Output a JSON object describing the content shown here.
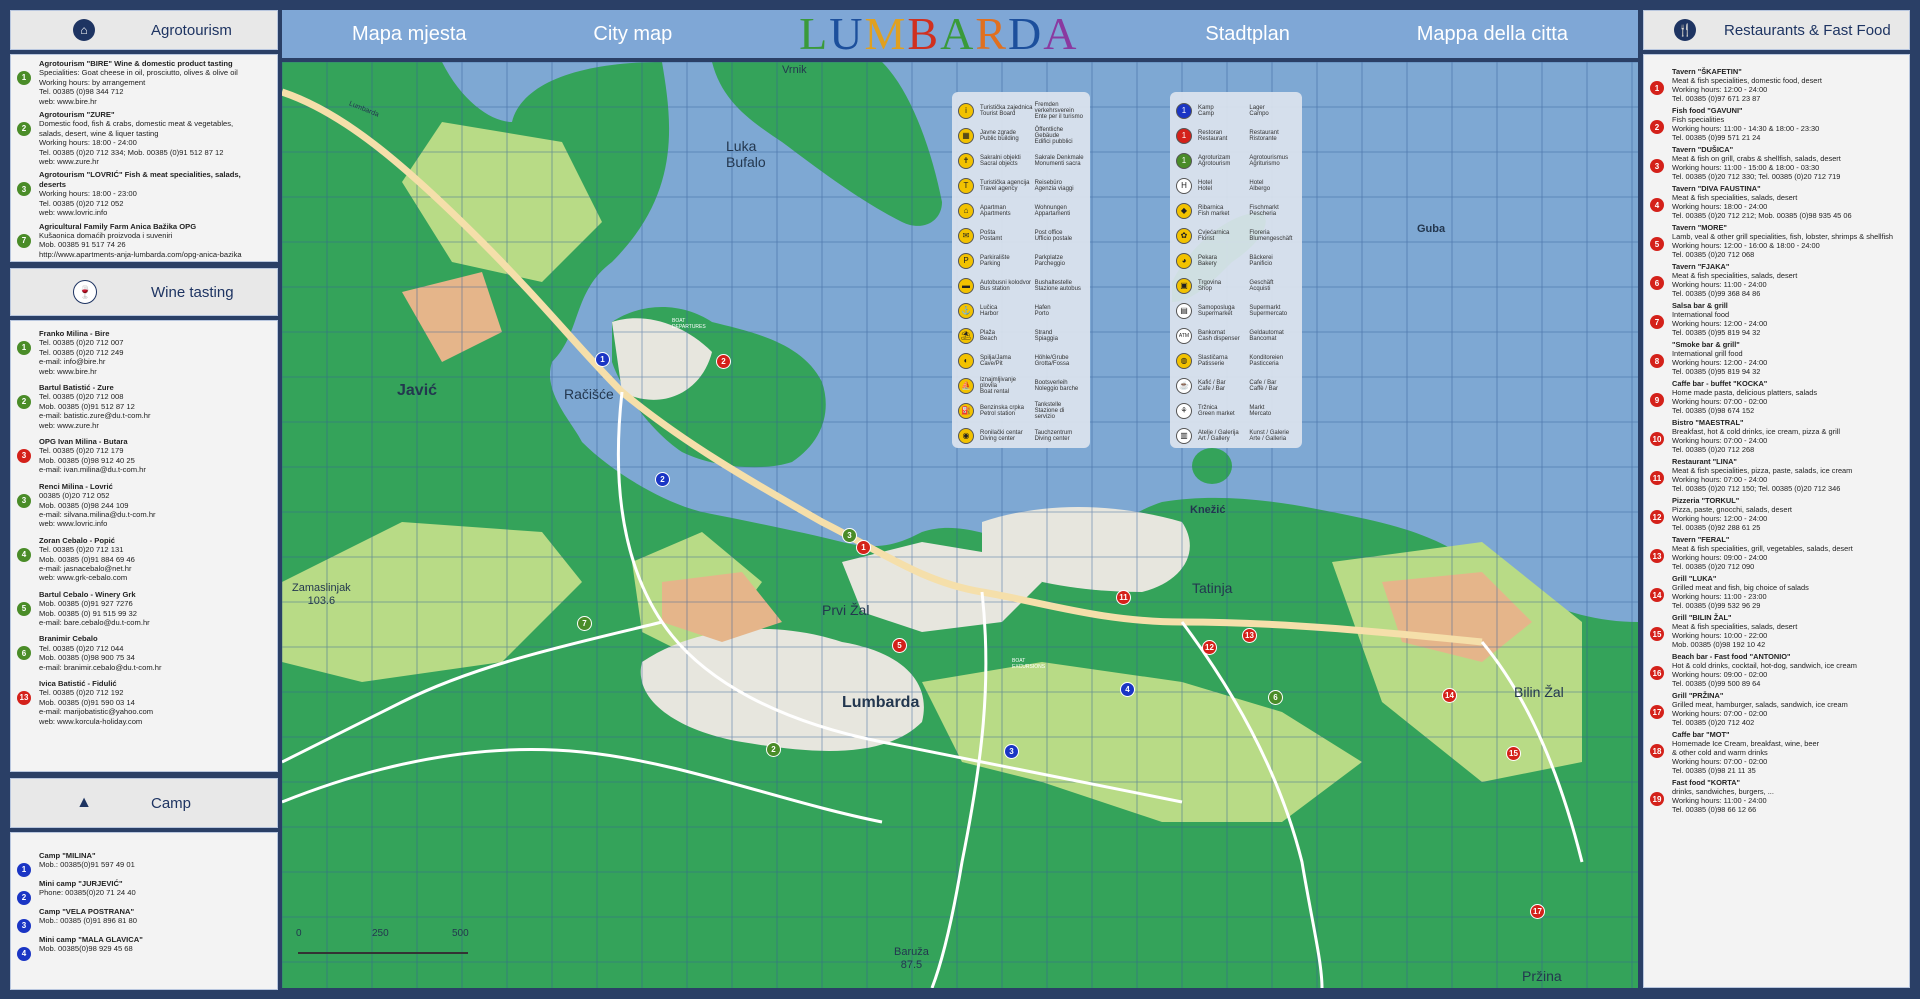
{
  "header": {
    "title_hr": "Mapa mjesta",
    "title_en": "City map",
    "logo": [
      "L",
      "U",
      "M",
      "B",
      "A",
      "R",
      "D",
      "A"
    ],
    "logo_colors": [
      "#3a9a3a",
      "#1c4f9c",
      "#e0a020",
      "#d03020",
      "#3a9a3a",
      "#e07020",
      "#1c4f9c",
      "#8a3aa0"
    ],
    "title_de": "Stadtplan",
    "title_it": "Mappa della citta"
  },
  "colors": {
    "frame": "#2a3f66",
    "header": "#7fa7d6",
    "sea": "#7ea8d3",
    "land": "#34a35a",
    "light_land": "#b8db86",
    "pale_land": "#e7e6de",
    "orange": "#e5b58a",
    "red_marker": "#d4211a",
    "green_marker": "#4a8c28",
    "blue_marker": "#1a35c4"
  },
  "left": {
    "agro": {
      "title": "Agrotourism",
      "icon": "house-icon",
      "entries": [
        {
          "n": "1",
          "color": "#4a8c28",
          "lines": [
            "Agrotourism \"BIRE\" Wine & domestic product tasting",
            "Specialities: Goat cheese in oil, prosciutto, olives & olive oil",
            "Working hours: by arrangement",
            "Tel. 00385 (0)98 344 712",
            "web: www.bire.hr"
          ]
        },
        {
          "n": "2",
          "color": "#4a8c28",
          "lines": [
            "Agrotourism \"ZURE\"",
            "Domestic food, fish & crabs, domestic meat & vegetables,",
            "salads, desert, wine & liquer tasting",
            "Working hours: 18:00 - 24:00",
            "Tel. 00385 (0)20 712 334; Mob. 00385 (0)91 512 87 12",
            "web: www.zure.hr"
          ]
        },
        {
          "n": "3",
          "color": "#4a8c28",
          "lines": [
            "Agrotourism \"LOVRIĆ\" Fish & meat specialities, salads, deserts",
            "Working hours: 18:00 - 23:00",
            "Tel. 00385 (0)20 712 052",
            "web: www.lovric.info"
          ]
        },
        {
          "n": "7",
          "color": "#4a8c28",
          "lines": [
            "Agricultural Family Farm Anica Bažika  OPG",
            "Kušaonica domaćih proizvoda i suveniri",
            "Mob. 00385 91 517 74 26",
            "http://www.apartments-anja-lumbarda.com/opg-anica-bazika"
          ]
        }
      ]
    },
    "wine": {
      "title": "Wine tasting",
      "icon": "wine-glass-icon",
      "entries": [
        {
          "n": "1",
          "color": "#4a8c28",
          "lines": [
            "Franko Milina - Bire",
            "Tel. 00385 (0)20 712 007",
            "Tel. 00385 (0)20 712 249",
            "e-mail: info@bire.hr",
            "web: www.bire.hr"
          ]
        },
        {
          "n": "2",
          "color": "#4a8c28",
          "lines": [
            "Bartul Batistić - Zure",
            "Tel. 00385 (0)20 712 008",
            "Mob. 00385 (0)91 512 87 12",
            "e-mail: batistic.zure@du.t-com.hr",
            "web: www.zure.hr"
          ]
        },
        {
          "n": "3",
          "color": "#d4211a",
          "lines": [
            "OPG Ivan Milina - Butara",
            "Tel. 00385 (0)20 712 179",
            "Mob. 00385 (0)98 912 40 25",
            "e-mail: ivan.milina@du.t-com.hr"
          ]
        },
        {
          "n": "3",
          "color": "#4a8c28",
          "lines": [
            "Renci Milina - Lovrić",
            "00385 (0)20 712 052",
            "Mob. 00385 (0)98 244 109",
            "e-mail: silvana.milina@du.t-com.hr",
            "web: www.lovric.info"
          ]
        },
        {
          "n": "4",
          "color": "#4a8c28",
          "lines": [
            "Zoran Cebalo - Popić",
            "Tel. 00385 (0)20 712 131",
            "Mob. 00385 (0)91 884 69 46",
            "e-mail: jasnacebalo@net.hr",
            "web: www.grk-cebalo.com"
          ]
        },
        {
          "n": "5",
          "color": "#4a8c28",
          "lines": [
            "Bartul Cebalo - Winery Grk",
            "Mob. 00385 (0)91 927 7276",
            "Mob. 00385 (0) 91 515 99 32",
            "e-mail: bare.cebalo@du.t-com.hr"
          ]
        },
        {
          "n": "6",
          "color": "#4a8c28",
          "lines": [
            "Branimir Cebalo",
            "Tel. 00385 (0)20 712 044",
            "Mob. 00385 (0)98 900 75 34",
            "e-mail: branimir.cebalo@du.t-com.hr"
          ]
        },
        {
          "n": "13",
          "color": "#d4211a",
          "lines": [
            "Ivica Batistić - Fidulić",
            "Tel. 00385 (0)20 712 192",
            "Mob. 00385 (0)91 590 03 14",
            "e-mail: marijobatistic@yahoo.com",
            "web: www.korcula-holiday.com"
          ]
        }
      ]
    },
    "camp": {
      "title": "Camp",
      "icon": "tent-icon",
      "entries": [
        {
          "n": "1",
          "color": "#1a35c4",
          "lines": [
            "Camp \"MILINA\"",
            "Mob.: 00385(0)91 597 49 01"
          ]
        },
        {
          "n": "2",
          "color": "#1a35c4",
          "lines": [
            "Mini camp \"JURJEVIĆ\"",
            "Phone: 00385(0)20 71 24 40"
          ]
        },
        {
          "n": "3",
          "color": "#1a35c4",
          "lines": [
            "Camp \"VELA POSTRANA\"",
            "Mob.: 00385 (0)91 896 81 80"
          ]
        },
        {
          "n": "4",
          "color": "#1a35c4",
          "lines": [
            "Mini camp \"MALA GLAVICA\"",
            "Mob. 00385(0)98 929 45 68"
          ]
        }
      ]
    }
  },
  "right": {
    "title": "Restaurants & Fast Food",
    "icon": "cutlery-icon",
    "entries": [
      {
        "n": "1",
        "lines": [
          "Tavern \"ŠKAFETIN\"",
          "Meat & fish specialities, domestic food, desert",
          "Working hours: 12:00 - 24:00",
          "Tel. 00385 (0)97 671 23 87"
        ]
      },
      {
        "n": "2",
        "lines": [
          "Fish food \"GAVUNI\"",
          "Fish specialities",
          "Working hours: 11:00 - 14:30 & 18:00 - 23:30",
          "Tel. 00385 (0)99 571 21 24"
        ]
      },
      {
        "n": "3",
        "lines": [
          "Tavern \"DUŠICA\"",
          "Meat & fish on grill, crabs & shellfish, salads, desert",
          "Working hours: 11:00 - 15:00 & 18:00 - 03:30",
          "Tel. 00385 (0)20 712 330; Tel. 00385 (0)20 712 719"
        ]
      },
      {
        "n": "4",
        "lines": [
          "Tavern \"DIVA FAUSTINA\"",
          "Meat & fish specialities, salads, desert",
          "Working hours: 18:00 - 24:00",
          "Tel. 00385 (0)20 712 212; Mob. 00385 (0)98 935 45 06"
        ]
      },
      {
        "n": "5",
        "lines": [
          "Tavern \"MORE\"",
          "Lamb, veal & other grill specialities, fish, lobster, shrimps & shellfish",
          "Working hours: 12:00 - 16:00 & 18:00 - 24:00",
          "Tel. 00385 (0)20 712 068"
        ]
      },
      {
        "n": "6",
        "lines": [
          "Tavern \"FJAKA\"",
          "Meat & fish specialities, salads, desert",
          "Working hours: 11:00 - 24:00",
          "Tel. 00385 (0)99 368 84 86"
        ]
      },
      {
        "n": "7",
        "lines": [
          "Salsa bar & grill",
          "International food",
          "Working hours: 12:00 - 24:00",
          "Tel. 00385 (0)95 819 94 32"
        ]
      },
      {
        "n": "8",
        "lines": [
          "\"Smoke bar & grill\"",
          "International grill food",
          "Working hours: 12:00 - 24:00",
          "Tel. 00385 (0)95 819 94 32"
        ]
      },
      {
        "n": "9",
        "lines": [
          "Caffe bar - buffet \"KOCKA\"",
          "Home made pasta, delicious platters, salads",
          "Working hours: 07:00 - 02:00",
          "Tel. 00385 (0)98 674 152"
        ]
      },
      {
        "n": "10",
        "lines": [
          "Bistro \"MAESTRAL\"",
          "Breakfast, hot & cold drinks, ice cream, pizza & grill",
          "Working hours: 07:00 - 24:00",
          "Tel. 00385 (0)20 712 268"
        ]
      },
      {
        "n": "11",
        "lines": [
          "Restaurant \"LINA\"",
          "Meat & fish specialities, pizza, paste, salads, ice cream",
          "Working hours: 07:00 - 24:00",
          "Tel. 00385 (0)20 712 150; Tel. 00385 (0)20 712 346"
        ]
      },
      {
        "n": "12",
        "lines": [
          "Pizzeria \"TORKUL\"",
          "Pizza, paste, gnocchi, salads, desert",
          "Working hours: 12:00 - 24:00",
          "Tel. 00385 (0)92 288 61 25"
        ]
      },
      {
        "n": "13",
        "lines": [
          "Tavern \"FERAL\"",
          "Meat & fish specialities, grill, vegetables, salads, desert",
          "Working hours: 09:00 - 24:00",
          "Tel. 00385 (0)20 712 090"
        ]
      },
      {
        "n": "14",
        "lines": [
          "Grill \"LUKA\"",
          "Grilled meat and fish, big choice of salads",
          "Working hours: 11:00 - 23:00",
          "Tel. 00385 (0)99 532 96 29"
        ]
      },
      {
        "n": "15",
        "lines": [
          "Grill \"BILIN ŽAL\"",
          "Meat & fish specialities, salads, desert",
          "Working hours: 10:00 - 22:00",
          "Mob. 00385 (0)98 192 10 42"
        ]
      },
      {
        "n": "16",
        "lines": [
          "Beach bar - Fast food \"ANTONIO\"",
          "Hot & cold drinks, cocktail, hot-dog, sandwich, ice cream",
          "Working hours: 09:00 - 02:00",
          "Tel. 00385 (0)99 500 89 64"
        ]
      },
      {
        "n": "17",
        "lines": [
          "Grill \"PRŽINA\"",
          "Grilled meat, hamburger, salads, sandwich, ice cream",
          "Working hours: 07:00 - 02:00",
          "Tel. 00385 (0)20 712 402"
        ]
      },
      {
        "n": "18",
        "lines": [
          "Caffe bar \"MOT\"",
          "Homemade Ice Cream, breakfast, wine, beer",
          "& other cold and warm drinks",
          "Working hours: 07:00 - 02:00",
          "Tel. 00385 (0)98 21 11 35"
        ]
      },
      {
        "n": "19",
        "lines": [
          "Fast food \"KORTA\"",
          "drinks, sandwiches, burgers, ...",
          "Working hours: 11:00 - 24:00",
          "Tel. 00385 (0)98 66 12 66"
        ]
      }
    ]
  },
  "map": {
    "places": {
      "vrnik": "Vrnik",
      "luka_bufalo": [
        "Luka",
        "Bufalo"
      ],
      "gubavac": "Guba",
      "javic": "Javić",
      "racisce": "Račišće",
      "knezic": "Knežić",
      "zamaslinjak": [
        "Zamaslinjak",
        "103.6"
      ],
      "prvi_zal": "Prvi Žal",
      "tatinja": "Tatinja",
      "lumbarda": "Lumbarda",
      "bilin_zal": "Bilin Žal",
      "baruza": [
        "Baruža",
        "87.5"
      ],
      "przina": "Pržina",
      "road": "Lumbarda",
      "boat_ferry": [
        "BOAT",
        "DEPARTURES"
      ],
      "boat_excursions": [
        "BOAT",
        "EXCURSIONS"
      ]
    },
    "scale": [
      "0",
      "250",
      "500"
    ],
    "legend1": [
      {
        "icon": "i",
        "c1": [
          "Turistička zajednica",
          "Tourist Board"
        ],
        "c2": [
          "Fremden",
          "verkehrsverein",
          "Ente per il turismo"
        ]
      },
      {
        "icon": "▦",
        "c1": [
          "Javne zgrade",
          "Public building"
        ],
        "c2": [
          "Öffentliche Gebäude",
          "Edifici pubblici"
        ]
      },
      {
        "icon": "✝",
        "c1": [
          "Sakralni objekti",
          "Sacral objects"
        ],
        "c2": [
          "Sakrale Denkmale",
          "Monumenti sacra"
        ]
      },
      {
        "icon": "T",
        "c1": [
          "Turistička agencija",
          "Travel agency"
        ],
        "c2": [
          "Reisebüro",
          "Agenzia viaggi"
        ]
      },
      {
        "icon": "⌂",
        "c1": [
          "Apartman",
          "Apartments"
        ],
        "c2": [
          "Wohnungen",
          "Appartamenti"
        ]
      },
      {
        "icon": "✉",
        "c1": [
          "Pošta",
          "Postamt"
        ],
        "c2": [
          "Post office",
          "Ufficio postale"
        ]
      },
      {
        "icon": "P",
        "c1": [
          "Parkiralište",
          "Parking"
        ],
        "c2": [
          "Parkplatze",
          "Parcheggio"
        ]
      },
      {
        "icon": "▬",
        "c1": [
          "Autobusni kolodvor",
          "Bus station"
        ],
        "c2": [
          "Bushaltestelle",
          "Stazione autobus"
        ]
      },
      {
        "icon": "⚓",
        "c1": [
          "Lučica",
          "Harbor"
        ],
        "c2": [
          "Hafen",
          "Porto"
        ]
      },
      {
        "icon": "⛱",
        "c1": [
          "Plaža",
          "Beach"
        ],
        "c2": [
          "Strand",
          "Spiaggia"
        ]
      },
      {
        "icon": "◐",
        "c1": [
          "Spilja/Jama",
          "Cave/Pit"
        ],
        "c2": [
          "Höhle/Grube",
          "Grotta/Fossa"
        ]
      },
      {
        "icon": "⛵",
        "c1": [
          "Iznajmljivanje plovila",
          "Boat rental"
        ],
        "c2": [
          "Bootsverleih",
          "Noleggio barche"
        ]
      },
      {
        "icon": "⛽",
        "c1": [
          "Benzinska crpka",
          "Petrol station"
        ],
        "c2": [
          "Tankstelle",
          "Stazione di servizio"
        ]
      },
      {
        "icon": "◉",
        "c1": [
          "Ronilački centar",
          "Diving center"
        ],
        "c2": [
          "Tauchzentrum",
          "Diving center"
        ]
      }
    ],
    "legend2": [
      {
        "icon": "1",
        "bg": "#1a35c4",
        "c1": [
          "Kamp",
          "Camp"
        ],
        "c2": [
          "Lager",
          "Campo"
        ]
      },
      {
        "icon": "1",
        "bg": "#d4211a",
        "c1": [
          "Restoran",
          "Restaurant"
        ],
        "c2": [
          "Restaurant",
          "Ristorante"
        ]
      },
      {
        "icon": "1",
        "bg": "#4a8c28",
        "c1": [
          "Agroturizam",
          "Agrotourism"
        ],
        "c2": [
          "Agrotourismus",
          "Agriturismo"
        ]
      },
      {
        "icon": "H",
        "bg": "#ffffff",
        "c1": [
          "Hotel",
          "Hotel"
        ],
        "c2": [
          "Hotel",
          "Albergo"
        ]
      },
      {
        "icon": "◆",
        "bg": "#f2c200",
        "c1": [
          "Ribarnica",
          "Fish market"
        ],
        "c2": [
          "Fischmarkt",
          "Pescheria"
        ]
      },
      {
        "icon": "✿",
        "bg": "#f2c200",
        "c1": [
          "Cvjećarnica",
          "Florist"
        ],
        "c2": [
          "Floreria",
          "Blumengeschäft"
        ]
      },
      {
        "icon": "◕",
        "bg": "#f2c200",
        "c1": [
          "Pekara",
          "Bakery"
        ],
        "c2": [
          "Bäckerei",
          "Panificio"
        ]
      },
      {
        "icon": "▣",
        "bg": "#f2c200",
        "c1": [
          "Trgovina",
          "Shop"
        ],
        "c2": [
          "Geschäft",
          "Acquisti"
        ]
      },
      {
        "icon": "▤",
        "bg": "#ffffff",
        "c1": [
          "Samoposluga",
          "Supermarket"
        ],
        "c2": [
          "Supermarkt",
          "Supermercato"
        ]
      },
      {
        "icon": "ATM",
        "bg": "#ffffff",
        "c1": [
          "Bankomat",
          "Cash dispenser"
        ],
        "c2": [
          "Geldautomat",
          "Bancomat"
        ]
      },
      {
        "icon": "◍",
        "bg": "#f2c200",
        "c1": [
          "Slastičarna",
          "Patisserie"
        ],
        "c2": [
          "Konditoreien",
          "Pasticceria"
        ]
      },
      {
        "icon": "☕",
        "bg": "#ffffff",
        "c1": [
          "Kafić / Bar",
          "Cafe / Bar"
        ],
        "c2": [
          "Cafe / Bar",
          "Caffè / Bar"
        ]
      },
      {
        "icon": "⚘",
        "bg": "#ffffff",
        "c1": [
          "Tržnica",
          "Green market"
        ],
        "c2": [
          "Markt",
          "Mercato"
        ]
      },
      {
        "icon": "▥",
        "bg": "#ffffff",
        "c1": [
          "Atelje / Galerija",
          "Art / Gallery"
        ],
        "c2": [
          "Kunst / Galerie",
          "Arte / Galleria"
        ]
      }
    ]
  }
}
